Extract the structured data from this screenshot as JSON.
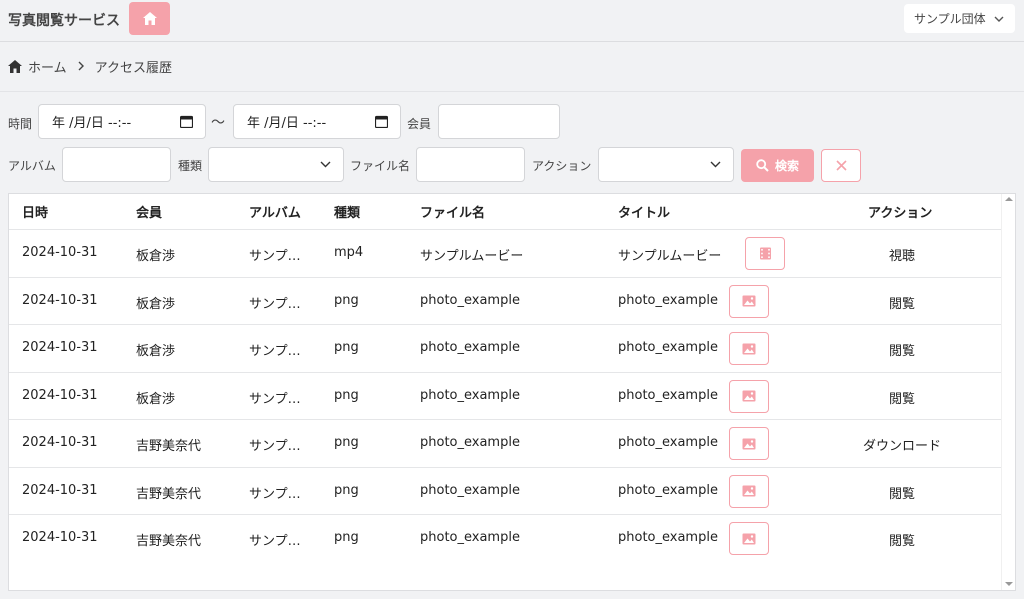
{
  "app": {
    "title": "写真閲覧サービス",
    "org": "サンプル団体"
  },
  "breadcrumb": {
    "home": "ホーム",
    "current": "アクセス履歴"
  },
  "filters": {
    "time_label": "時間",
    "date_from": "年 /月/日 --:--",
    "date_to": "年 /月/日 --:--",
    "tilde": "～",
    "member_label": "会員",
    "member_value": "",
    "album_label": "アルバム",
    "album_value": "",
    "type_label": "種類",
    "filename_label": "ファイル名",
    "filename_value": "",
    "action_label": "アクション",
    "search_label": "検索"
  },
  "table": {
    "headers": [
      "日時",
      "会員",
      "アルバム",
      "種類",
      "ファイル名",
      "タイトル",
      "アクション"
    ],
    "rows": [
      {
        "date": "2024-10-31",
        "member": "板倉渉",
        "album": "サンプ…",
        "type": "mp4",
        "filename": "サンプルムービー",
        "title": "サンプルムービー",
        "thumb": "film-icon",
        "action": "視聴"
      },
      {
        "date": "2024-10-31",
        "member": "板倉渉",
        "album": "サンプ…",
        "type": "png",
        "filename": "photo_example",
        "title": "photo_example",
        "thumb": "image-icon",
        "action": "閲覧"
      },
      {
        "date": "2024-10-31",
        "member": "板倉渉",
        "album": "サンプ…",
        "type": "png",
        "filename": "photo_example",
        "title": "photo_example",
        "thumb": "image-icon",
        "action": "閲覧"
      },
      {
        "date": "2024-10-31",
        "member": "板倉渉",
        "album": "サンプ…",
        "type": "png",
        "filename": "photo_example",
        "title": "photo_example",
        "thumb": "image-icon",
        "action": "閲覧"
      },
      {
        "date": "2024-10-31",
        "member": "吉野美奈代",
        "album": "サンプ…",
        "type": "png",
        "filename": "photo_example",
        "title": "photo_example",
        "thumb": "image-icon",
        "action": "ダウンロード"
      },
      {
        "date": "2024-10-31",
        "member": "吉野美奈代",
        "album": "サンプ…",
        "type": "png",
        "filename": "photo_example",
        "title": "photo_example",
        "thumb": "image-icon",
        "action": "閲覧"
      },
      {
        "date": "2024-10-31",
        "member": "吉野美奈代",
        "album": "サンプ…",
        "type": "png",
        "filename": "photo_example",
        "title": "photo_example",
        "thumb": "image-icon",
        "action": "閲覧"
      }
    ]
  },
  "colors": {
    "accent": "#f5a2aa",
    "background": "#f1f2f4"
  }
}
